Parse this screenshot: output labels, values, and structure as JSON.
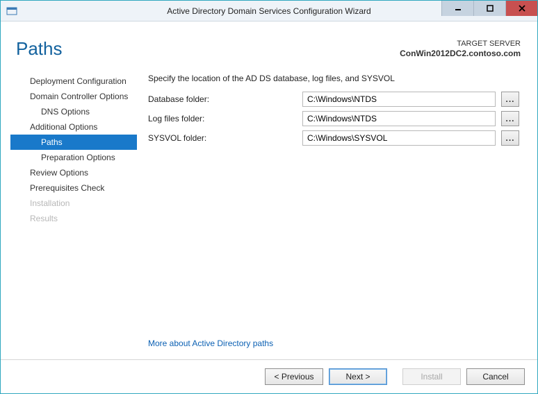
{
  "window": {
    "title": "Active Directory Domain Services Configuration Wizard"
  },
  "header": {
    "heading": "Paths",
    "target_label": "TARGET SERVER",
    "target_host": "ConWin2012DC2.contoso.com"
  },
  "nav": {
    "items": [
      {
        "label": "Deployment Configuration",
        "indent": 0,
        "state": "normal"
      },
      {
        "label": "Domain Controller Options",
        "indent": 0,
        "state": "normal"
      },
      {
        "label": "DNS Options",
        "indent": 1,
        "state": "normal"
      },
      {
        "label": "Additional Options",
        "indent": 0,
        "state": "normal"
      },
      {
        "label": "Paths",
        "indent": 1,
        "state": "selected"
      },
      {
        "label": "Preparation Options",
        "indent": 1,
        "state": "normal"
      },
      {
        "label": "Review Options",
        "indent": 0,
        "state": "normal"
      },
      {
        "label": "Prerequisites Check",
        "indent": 0,
        "state": "normal"
      },
      {
        "label": "Installation",
        "indent": 0,
        "state": "disabled"
      },
      {
        "label": "Results",
        "indent": 0,
        "state": "disabled"
      }
    ]
  },
  "page": {
    "instruction": "Specify the location of the AD DS database, log files, and SYSVOL",
    "fields": {
      "database": {
        "label": "Database folder:",
        "value": "C:\\Windows\\NTDS",
        "browse": "..."
      },
      "logfiles": {
        "label": "Log files folder:",
        "value": "C:\\Windows\\NTDS",
        "browse": "..."
      },
      "sysvol": {
        "label": "SYSVOL folder:",
        "value": "C:\\Windows\\SYSVOL",
        "browse": "..."
      }
    },
    "more_link": "More about Active Directory paths"
  },
  "footer": {
    "previous": "< Previous",
    "next": "Next >",
    "install": "Install",
    "cancel": "Cancel"
  }
}
